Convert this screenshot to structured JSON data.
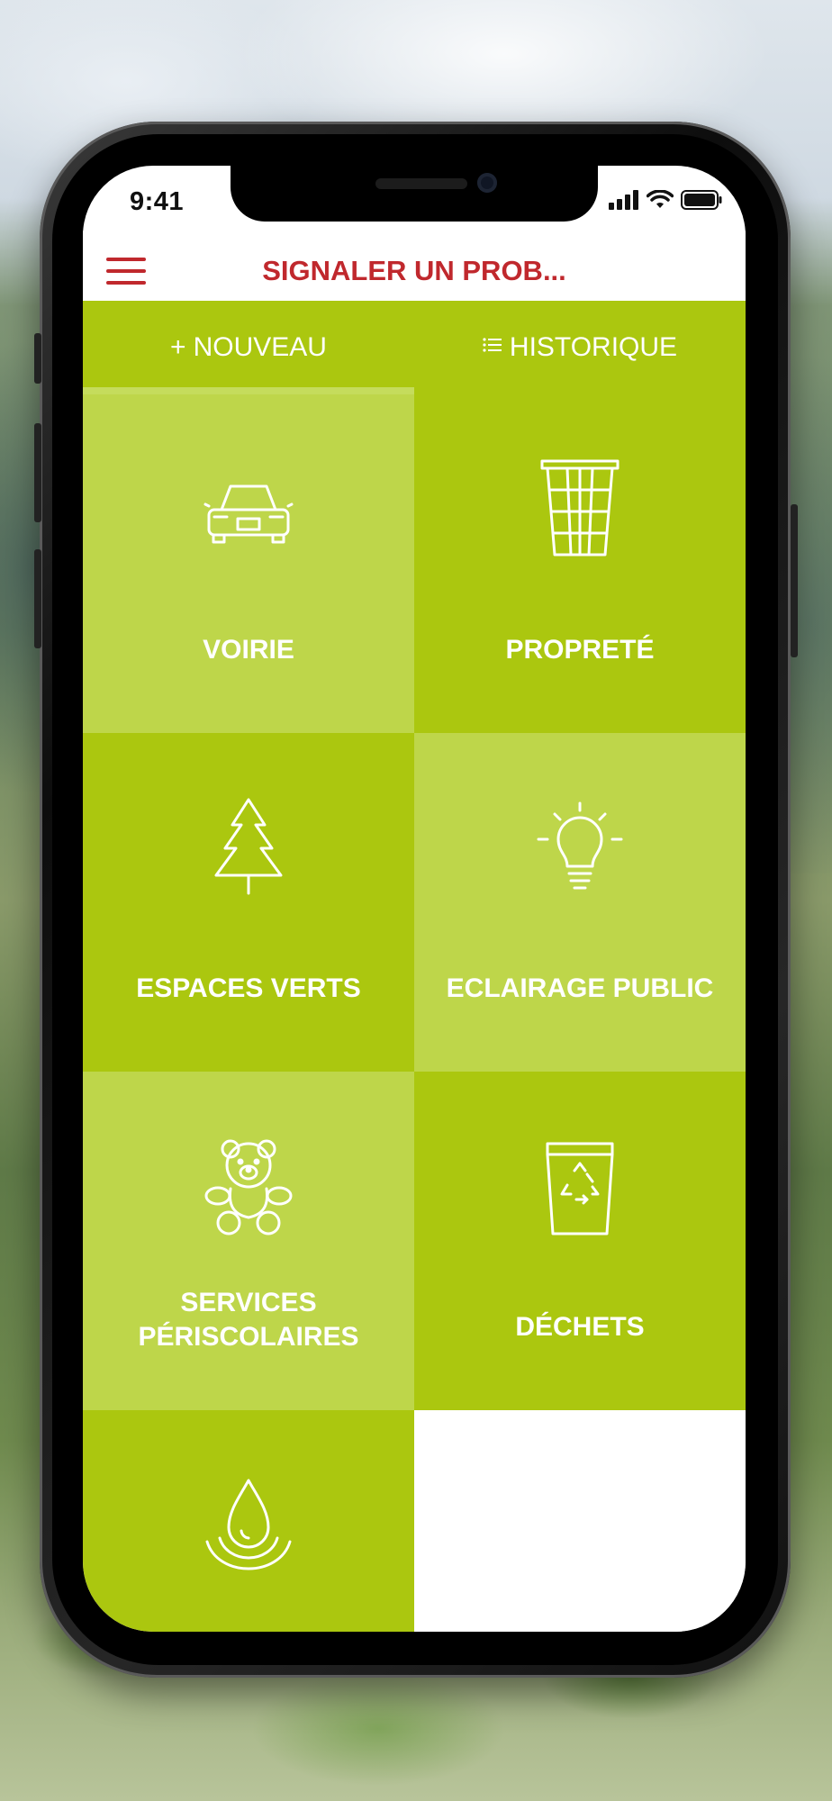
{
  "status_bar": {
    "time": "9:41"
  },
  "app": {
    "title": "SIGNALER UN PROB..."
  },
  "tabs": [
    {
      "glyph": "+",
      "label": "NOUVEAU",
      "active": true
    },
    {
      "glyph": "☰",
      "label": "HISTORIQUE",
      "active": false
    }
  ],
  "categories": [
    {
      "label": "VOIRIE",
      "icon": "car-icon"
    },
    {
      "label": "PROPRETÉ",
      "icon": "wastebasket-icon"
    },
    {
      "label": "ESPACES VERTS",
      "icon": "tree-icon"
    },
    {
      "label": "ECLAIRAGE PUBLIC",
      "icon": "lightbulb-icon"
    },
    {
      "label": "SERVICES",
      "label_line2": "PÉRISCOLAIRES",
      "icon": "teddy-bear-icon"
    },
    {
      "label": "DÉCHETS",
      "icon": "recycling-bin-icon"
    },
    {
      "label": "",
      "icon": "water-drop-icon"
    }
  ],
  "colors": {
    "accent_red": "#c0282d",
    "tile_dark": "#abc70f",
    "tile_light": "#bed64a"
  }
}
